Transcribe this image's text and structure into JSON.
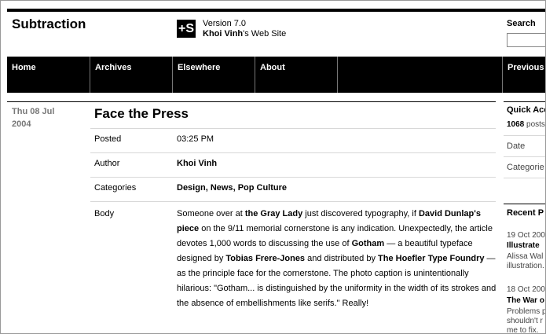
{
  "header": {
    "site_title": "Subtraction",
    "logo_text": "+S",
    "version": "Version 7.0",
    "author_name": "Khoi Vinh",
    "author_suffix": "'s Web Site",
    "search_label": "Search",
    "search_value": ""
  },
  "nav": {
    "items": [
      {
        "label": "Home"
      },
      {
        "label": "Archives"
      },
      {
        "label": "Elsewhere"
      },
      {
        "label": "About"
      },
      {
        "label": ""
      },
      {
        "label": "Previous"
      }
    ]
  },
  "post": {
    "date_line1": "Thu 08 Jul",
    "date_line2": "2004",
    "title": "Face the Press",
    "posted_label": "Posted",
    "posted_value": "03:25 PM",
    "author_label": "Author",
    "author_value": "Khoi Vinh",
    "categories_label": "Categories",
    "categories": [
      "Design",
      "News",
      "Pop Culture"
    ],
    "body_label": "Body",
    "body": {
      "t1": "Someone over at ",
      "l1": "the Gray Lady",
      "t2": " just discovered typography, if ",
      "l2": "David Dunlap's piece",
      "t3": " on the 9/11 memorial cornerstone is any indication. Unexpectedly, the article devotes 1,000 words to discussing the use of ",
      "l3": "Gotham",
      "t4": " — a beautiful typeface designed by ",
      "l4": "Tobias Frere-Jones",
      "t5": " and distributed by ",
      "l5": "The Hoefler Type Foundry",
      "t6": " — as the principle face for the cornerstone. The photo caption is unintentionally hilarious: \"Gotham... is distinguished by the uniformity in the width of its strokes and the absence of embellishments like serifs.\" Really!"
    }
  },
  "sidebar": {
    "quick_access": "Quick Acc",
    "post_count": "1068",
    "post_count_suffix": " posts",
    "date_label": "Date",
    "categories_label": "Categorie",
    "recent_heading": "Recent P",
    "recent": [
      {
        "date": "19 Oct 200",
        "title": "Illustrate",
        "desc1": "Alissa Wal",
        "desc2": "illustration."
      },
      {
        "date": "18 Oct 200",
        "title": "The War o",
        "desc1": "Problems p",
        "desc2": "shouldn't r",
        "desc3": "me to fix."
      }
    ]
  }
}
